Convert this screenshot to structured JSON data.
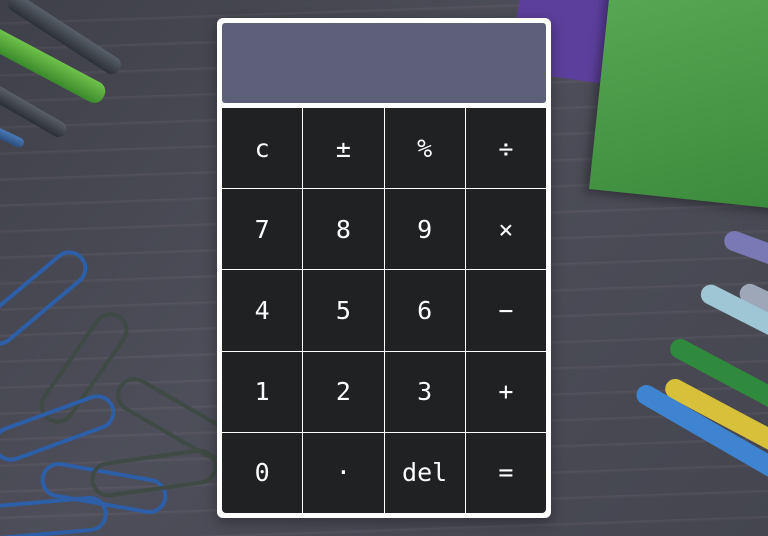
{
  "display": {
    "value": ""
  },
  "keys": [
    {
      "label": "c",
      "name": "clear-key"
    },
    {
      "label": "±",
      "name": "plus-minus-key"
    },
    {
      "label": "%",
      "name": "percent-key"
    },
    {
      "label": "÷",
      "name": "divide-key"
    },
    {
      "label": "7",
      "name": "digit-7-key"
    },
    {
      "label": "8",
      "name": "digit-8-key"
    },
    {
      "label": "9",
      "name": "digit-9-key"
    },
    {
      "label": "×",
      "name": "multiply-key"
    },
    {
      "label": "4",
      "name": "digit-4-key"
    },
    {
      "label": "5",
      "name": "digit-5-key"
    },
    {
      "label": "6",
      "name": "digit-6-key"
    },
    {
      "label": "−",
      "name": "subtract-key"
    },
    {
      "label": "1",
      "name": "digit-1-key"
    },
    {
      "label": "2",
      "name": "digit-2-key"
    },
    {
      "label": "3",
      "name": "digit-3-key"
    },
    {
      "label": "+",
      "name": "add-key"
    },
    {
      "label": "0",
      "name": "digit-0-key"
    },
    {
      "label": "·",
      "name": "decimal-point-key"
    },
    {
      "label": "del",
      "name": "delete-key"
    },
    {
      "label": "=",
      "name": "equals-key"
    }
  ],
  "colors": {
    "display_bg": "#5d6078",
    "key_bg": "#1f2123",
    "frame": "#ffffff",
    "text": "#ffffff"
  }
}
